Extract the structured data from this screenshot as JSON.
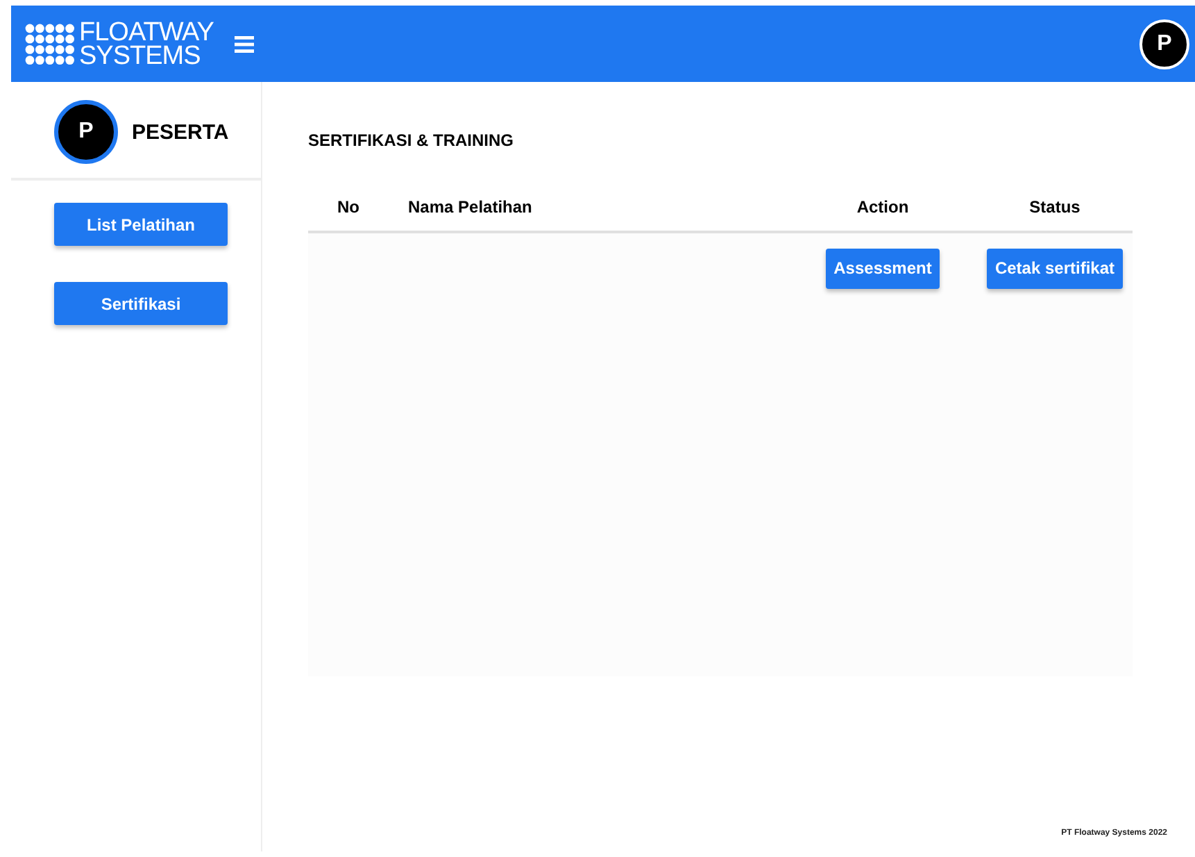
{
  "header": {
    "logo_line_1": "FLOATWAY",
    "logo_line_2": "SYSTEMS",
    "avatar": "P"
  },
  "sidebar": {
    "avatar": "P",
    "role": "PESERTA",
    "items": [
      {
        "label": "List Pelatihan"
      },
      {
        "label": "Sertifikasi"
      }
    ]
  },
  "page_title": "SERTIFIKASI & TRAINING",
  "table": {
    "columns": [
      "No",
      "Nama Pelatihan",
      "Action",
      "Status"
    ],
    "rows": [
      {
        "no": "",
        "name": "",
        "action": "Assessment",
        "status": "Cetak sertifikat"
      }
    ]
  },
  "footer": "PT Floatway Systems 2022"
}
